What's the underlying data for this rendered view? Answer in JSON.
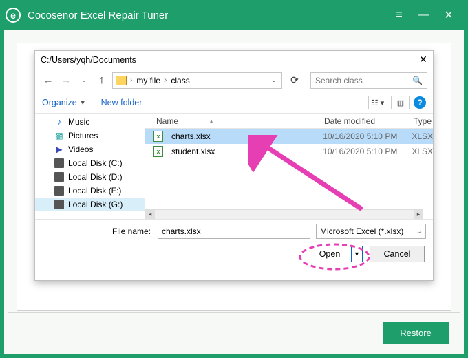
{
  "app": {
    "title": "Cocosenor Excel Repair Tuner",
    "logo_letter": "e"
  },
  "restore_button": "Restore",
  "dialog": {
    "title_path": "C:/Users/yqh/Documents",
    "breadcrumb": {
      "root_icon": "folder",
      "items": [
        "my file",
        "class"
      ]
    },
    "search_placeholder": "Search class",
    "toolbar": {
      "organize": "Organize",
      "new_folder": "New folder"
    },
    "side_items": [
      {
        "label": "Music",
        "icon": "music"
      },
      {
        "label": "Pictures",
        "icon": "pictures"
      },
      {
        "label": "Videos",
        "icon": "videos"
      },
      {
        "label": "Local Disk (C:)",
        "icon": "disk"
      },
      {
        "label": "Local Disk (D:)",
        "icon": "disk"
      },
      {
        "label": "Local Disk (F:)",
        "icon": "disk"
      },
      {
        "label": "Local Disk (G:)",
        "icon": "disk"
      }
    ],
    "columns": {
      "name": "Name",
      "date": "Date modified",
      "type": "Type"
    },
    "files": [
      {
        "name": "charts.xlsx",
        "date": "10/16/2020 5:10 PM",
        "type": "XLSX",
        "selected": true
      },
      {
        "name": "student.xlsx",
        "date": "10/16/2020 5:10 PM",
        "type": "XLSX",
        "selected": false
      }
    ],
    "filename_label": "File name:",
    "filename_value": "charts.xlsx",
    "filetype_label": "Microsoft Excel (*.xlsx)",
    "open_label": "Open",
    "cancel_label": "Cancel"
  }
}
